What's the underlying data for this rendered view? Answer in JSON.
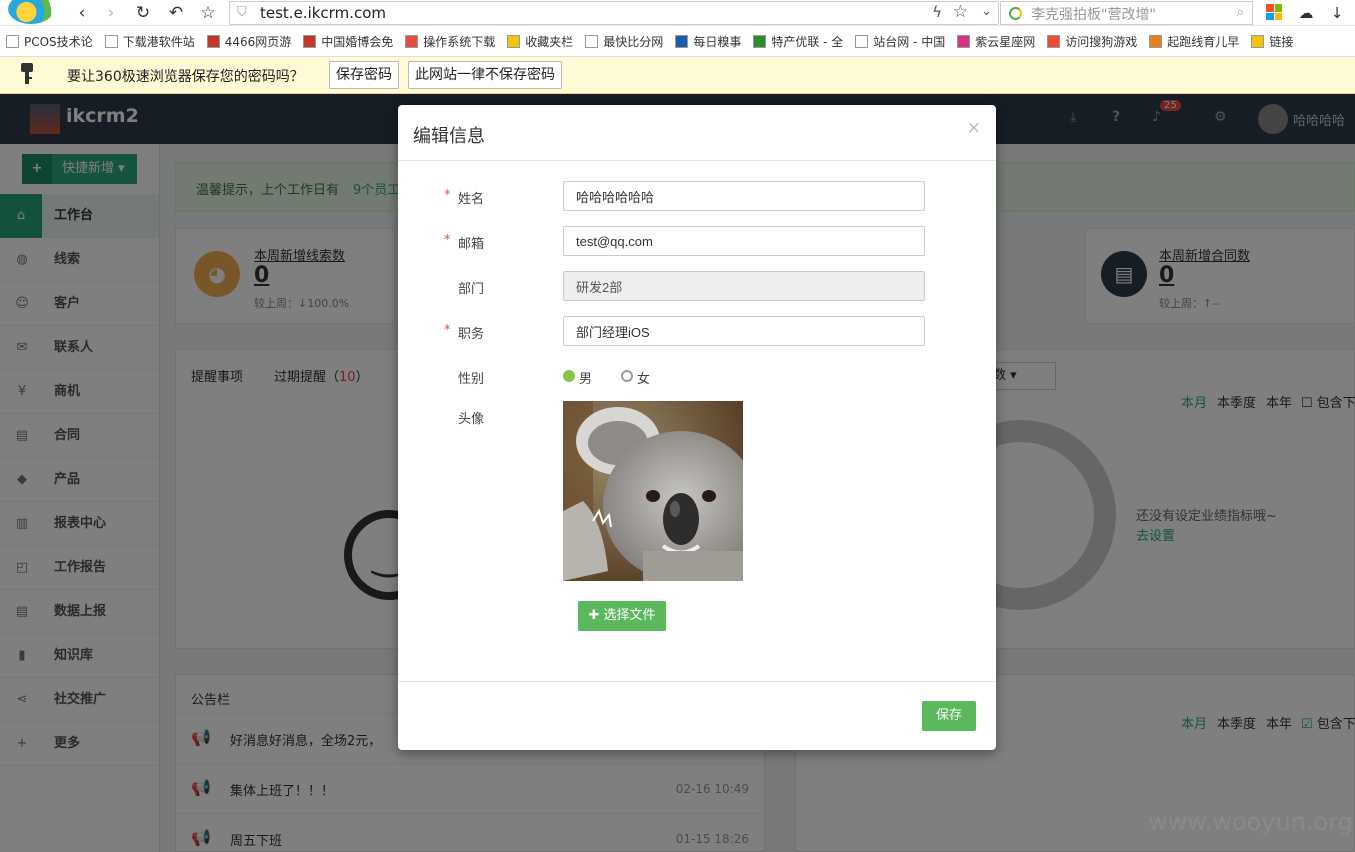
{
  "browser": {
    "url": "test.e.ikcrm.com",
    "search_placeholder": "李克强拍板\"营改增\"",
    "bookmarks": [
      "PCOS技术论",
      "下载港软件站",
      "4466网页游",
      "中国婚博会免",
      "操作系统下载",
      "收藏夹栏",
      "最快比分网",
      "每日糗事",
      "特产优联 - 全",
      "站台网 - 中国",
      "紫云星座网",
      "访问搜狗游戏",
      "起跑线育儿早",
      "链接"
    ],
    "password_bar": {
      "message": "要让360极速浏览器保存您的密码吗？",
      "save_label": "保存密码",
      "never_label": "此网站一律不保存密码"
    }
  },
  "app": {
    "title": "ikcrm2",
    "notification_count": "25",
    "user_name": "哈哈哈哈",
    "quick_add": "快捷新增",
    "tip": "温馨提示，上个工作日有",
    "tip_link": "9个员工",
    "sidebar": [
      {
        "icon": "⌂",
        "label": "工作台",
        "name": "sidebar-item-workbench"
      },
      {
        "icon": "◍",
        "label": "线索",
        "name": "sidebar-item-leads"
      },
      {
        "icon": "☺",
        "label": "客户",
        "name": "sidebar-item-customers"
      },
      {
        "icon": "✉",
        "label": "联系人",
        "name": "sidebar-item-contacts"
      },
      {
        "icon": "¥",
        "label": "商机",
        "name": "sidebar-item-opportunities"
      },
      {
        "icon": "▤",
        "label": "合同",
        "name": "sidebar-item-contracts"
      },
      {
        "icon": "◆",
        "label": "产品",
        "name": "sidebar-item-products"
      },
      {
        "icon": "▥",
        "label": "报表中心",
        "name": "sidebar-item-reports"
      },
      {
        "icon": "◰",
        "label": "工作报告",
        "name": "sidebar-item-work-reports"
      },
      {
        "icon": "▤",
        "label": "数据上报",
        "name": "sidebar-item-data-report"
      },
      {
        "icon": "▮",
        "label": "知识库",
        "name": "sidebar-item-knowledge"
      },
      {
        "icon": "⋖",
        "label": "社交推广",
        "name": "sidebar-item-social"
      },
      {
        "icon": "+",
        "label": "更多",
        "name": "sidebar-item-more"
      }
    ],
    "stats": {
      "leads_title": "本周新增线索数",
      "leads_value": "0",
      "leads_compare": "较上周：↓100.0%",
      "contracts_title": "本周新增合同数",
      "contracts_value": "0",
      "contracts_compare": "较上周：↑--"
    },
    "reminders": {
      "tab1": "提醒事项",
      "tab2": "过期提醒（",
      "tab2_count": "10",
      "tab2_suffix": "）"
    },
    "goal": {
      "dropdown": "数",
      "periods": [
        "本月",
        "本季度",
        "本年"
      ],
      "include": "包含下",
      "empty": "还没有设定业绩指标哦~",
      "link": "去设置"
    },
    "notices": {
      "title": "公告栏",
      "items": [
        {
          "text": "好消息好消息，全场2元，",
          "time": ""
        },
        {
          "text": "集体上班了！！！",
          "time": "02-16 10:49"
        },
        {
          "text": "周五下班",
          "time": "01-15 18:26"
        }
      ]
    }
  },
  "modal": {
    "title": "编辑信息",
    "close": "×",
    "fields": {
      "name_label": "姓名",
      "name_value": "哈哈哈哈哈哈",
      "email_label": "邮箱",
      "email_value": "test@qq.com",
      "dept_label": "部门",
      "dept_value": "研发2部",
      "position_label": "职务",
      "position_value": "部门经理iOS",
      "gender_label": "性别",
      "gender_male": "男",
      "gender_female": "女",
      "avatar_label": "头像"
    },
    "choose_file": "选择文件",
    "save": "保存"
  },
  "watermark": "www.wooyun.org",
  "colors": {
    "accent": "#5cb85c",
    "header": "#2c3a4b",
    "sidebar_active": "#25a37c"
  }
}
